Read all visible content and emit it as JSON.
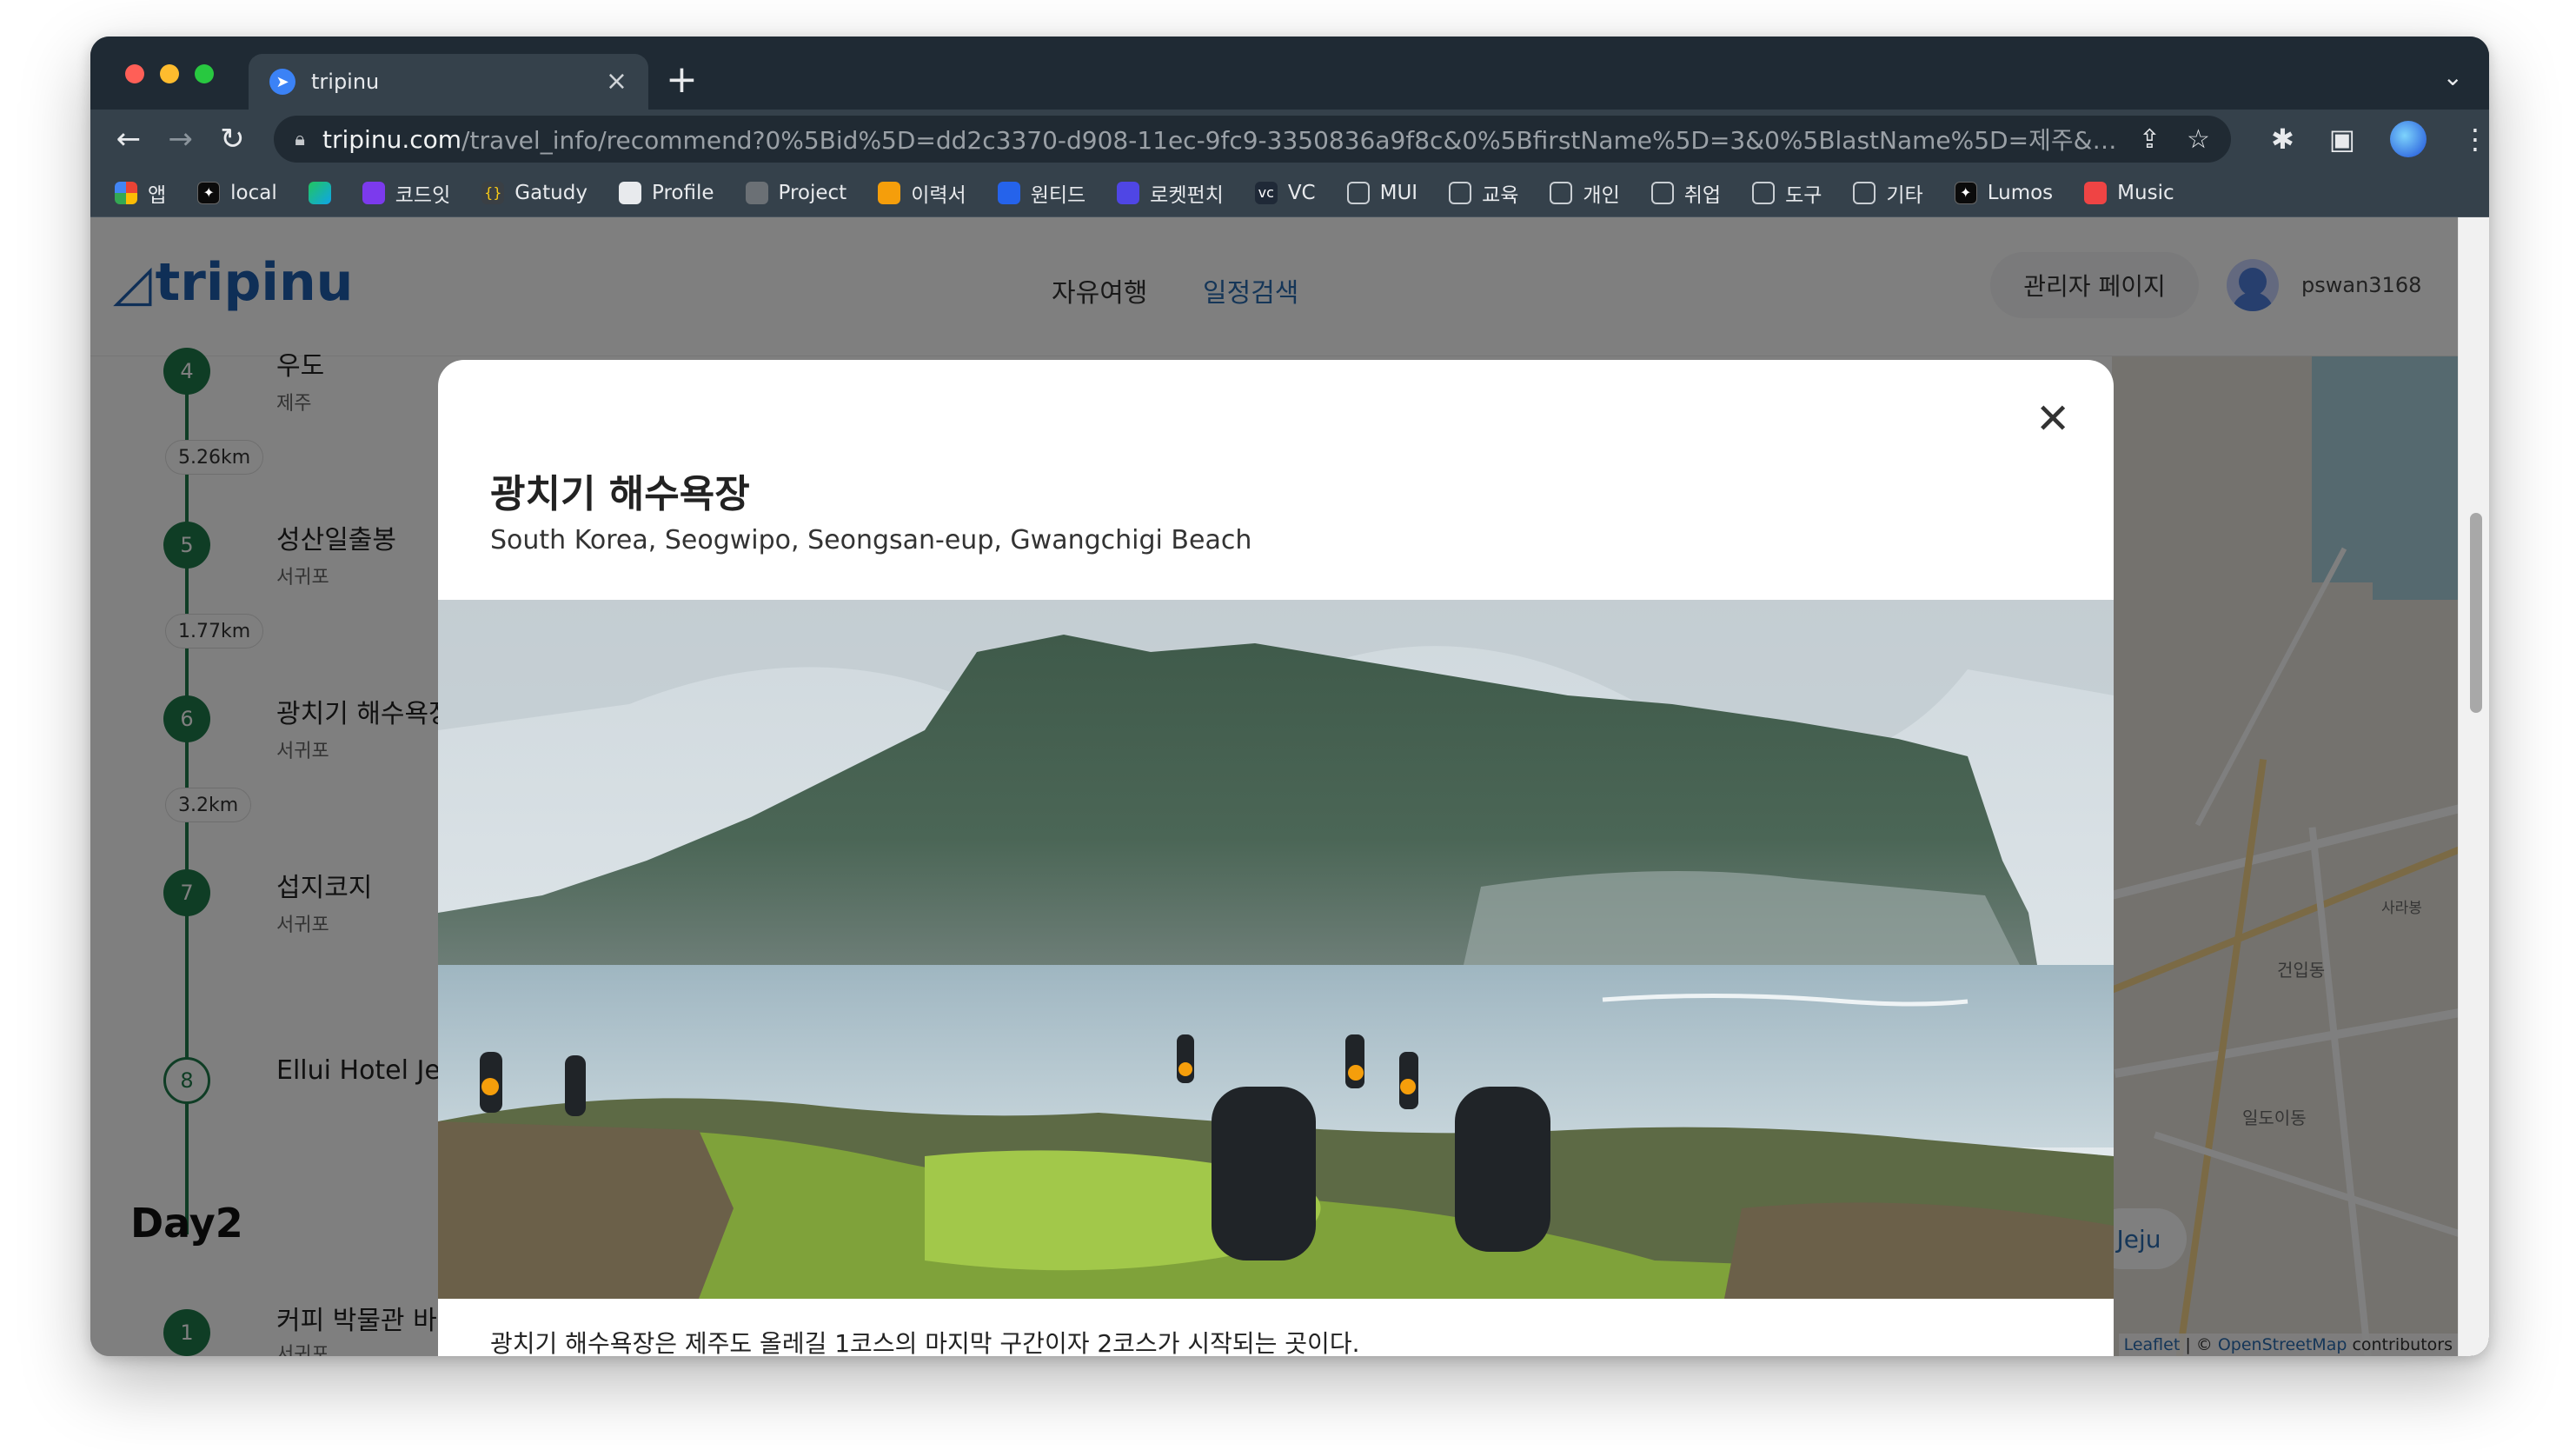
{
  "browser": {
    "tab_title": "tripinu",
    "url_host": "tripinu.com",
    "url_path": "/travel_info/recommend?0%5Bid%5D=dd2c3370-d908-11ec-9fc9-3350836a9f8c&0%5BfirstName%5D=3&0%5BlastName%5D=제주&0%5Bselect_na...",
    "bookmarks": [
      {
        "label": "앱",
        "icon": "apps-grid-icon"
      },
      {
        "label": "local",
        "icon": "local-icon"
      },
      {
        "label": "",
        "icon": "edge-icon"
      },
      {
        "label": "코드잇",
        "icon": "codeit-icon"
      },
      {
        "label": "Gatudy",
        "icon": "braces-icon"
      },
      {
        "label": "Profile",
        "icon": "github-icon"
      },
      {
        "label": "Project",
        "icon": "github-icon"
      },
      {
        "label": "이력서",
        "icon": "resume-icon"
      },
      {
        "label": "원티드",
        "icon": "wanted-icon"
      },
      {
        "label": "로켓펀치",
        "icon": "rocketpunch-icon"
      },
      {
        "label": "VC",
        "icon": "vc-icon"
      },
      {
        "label": "MUI",
        "icon": "folder-icon"
      },
      {
        "label": "교육",
        "icon": "folder-icon"
      },
      {
        "label": "개인",
        "icon": "folder-icon"
      },
      {
        "label": "취업",
        "icon": "folder-icon"
      },
      {
        "label": "도구",
        "icon": "folder-icon"
      },
      {
        "label": "기타",
        "icon": "folder-icon"
      },
      {
        "label": "Lumos",
        "icon": "lumos-icon"
      },
      {
        "label": "Music",
        "icon": "music-icon"
      }
    ]
  },
  "site": {
    "logo_text": "tripinu",
    "nav": [
      {
        "label": "자유여행",
        "active": false
      },
      {
        "label": "일정검색",
        "active": true
      }
    ],
    "admin_label": "관리자 페이지",
    "username": "pswan3168"
  },
  "itinerary": {
    "stops": [
      {
        "number": "4",
        "name": "우도",
        "region": "제주"
      },
      {
        "number": "5",
        "name": "성산일출봉",
        "region": "서귀포"
      },
      {
        "number": "6",
        "name": "광치기 해수욕장",
        "region": "서귀포"
      },
      {
        "number": "7",
        "name": "섭지코지",
        "region": "서귀포"
      },
      {
        "number": "8",
        "name": "Ellui Hotel Jeju",
        "region": ""
      }
    ],
    "distances": [
      "5.26km",
      "1.77km",
      "3.2km"
    ],
    "day2_title": "Day2",
    "day2_first": {
      "number": "1",
      "name": "커피 박물관 바움",
      "region": "서귀포"
    }
  },
  "map": {
    "jeju_label": "Jeju",
    "labels": [
      "건입동",
      "일도이동",
      "사라봉"
    ],
    "attribution_leaflet": "Leaflet",
    "attribution_sep": " | © ",
    "attribution_osm": "OpenStreetMap",
    "attribution_tail": " contributors"
  },
  "modal": {
    "title": "광치기 해수욕장",
    "subtitle": "South Korea, Seogwipo, Seongsan-eup, Gwangchigi Beach",
    "description": "광치기 해수욕장은 제주도 올레길 1코스의 마지막 구간이자 2코스가 시작되는 곳이다."
  },
  "colors": {
    "brand": "#1e5fae",
    "timeline_green": "#1f7a4a",
    "nav_active": "#2b6cb0"
  }
}
